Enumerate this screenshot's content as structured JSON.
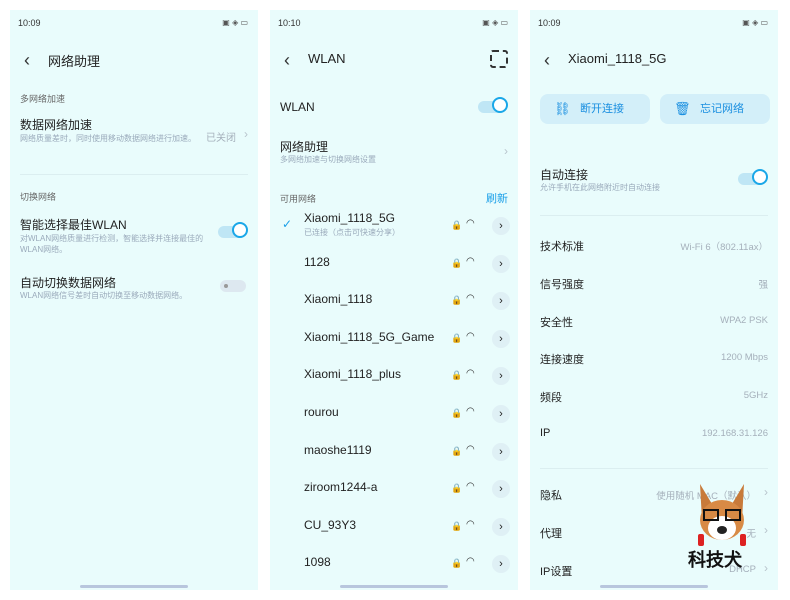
{
  "panel1": {
    "time": "10:09",
    "title": "网络助理",
    "section1": "多网络加速",
    "data_accel": {
      "title": "数据网络加速",
      "desc": "网络质量差时，同时使用移动数据网络进行加速。",
      "value": "已关闭"
    },
    "section2": "切换网络",
    "smart_wlan": {
      "title": "智能选择最佳WLAN",
      "desc": "对WLAN网络质量进行检测，智能选择并连接最佳的WLAN网络。",
      "on": true
    },
    "auto_switch": {
      "title": "自动切换数据网络",
      "desc": "WLAN网络信号差时自动切换至移动数据网络。",
      "on": false
    }
  },
  "panel2": {
    "time": "10:10",
    "title": "WLAN",
    "wlan_label": "WLAN",
    "wlan_on": true,
    "assistant": {
      "title": "网络助理",
      "desc": "多网络加速与切换网络设置"
    },
    "available": "可用网络",
    "refresh": "刷新",
    "networks": [
      {
        "name": "Xiaomi_1118_5G",
        "status": "已连接（点击可快速分享）",
        "connected": true
      },
      {
        "name": "1128"
      },
      {
        "name": "Xiaomi_1118"
      },
      {
        "name": "Xiaomi_1118_5G_Game"
      },
      {
        "name": "Xiaomi_1118_plus"
      },
      {
        "name": "rourou"
      },
      {
        "name": "maoshe1119"
      },
      {
        "name": "ziroom1244-a"
      },
      {
        "name": "CU_93Y3"
      },
      {
        "name": "1098"
      }
    ]
  },
  "panel3": {
    "time": "10:09",
    "title": "Xiaomi_1118_5G",
    "disconnect": "断开连接",
    "forget": "忘记网络",
    "auto_connect": {
      "title": "自动连接",
      "desc": "允许手机在此网络附近时自动连接",
      "on": true
    },
    "props": [
      {
        "k": "技术标准",
        "v": "Wi-Fi 6（802.11ax）"
      },
      {
        "k": "信号强度",
        "v": "强"
      },
      {
        "k": "安全性",
        "v": "WPA2 PSK"
      },
      {
        "k": "连接速度",
        "v": "1200 Mbps"
      },
      {
        "k": "频段",
        "v": "5GHz"
      },
      {
        "k": "IP",
        "v": "192.168.31.126"
      }
    ],
    "links": [
      {
        "k": "隐私",
        "v": "使用随机 MAC（默认）"
      },
      {
        "k": "代理",
        "v": "无"
      },
      {
        "k": "IP设置",
        "v": "DHCP"
      }
    ]
  },
  "watermark": "科技犬",
  "colors": {
    "bg": "#e9fcfc",
    "accent": "#1aa7e8"
  }
}
